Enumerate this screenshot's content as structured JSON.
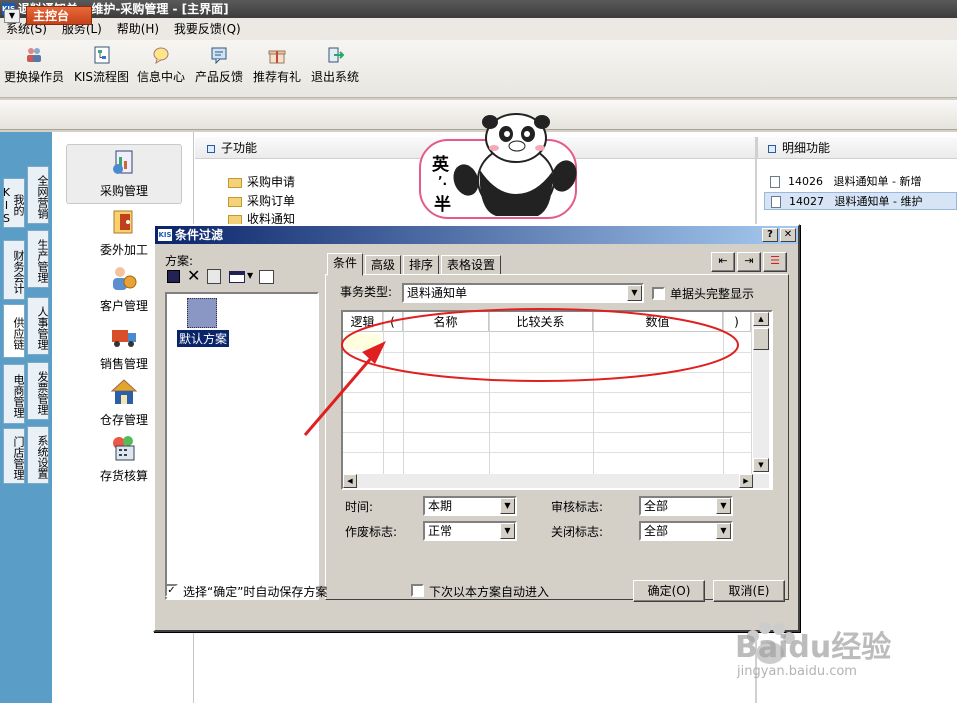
{
  "app": {
    "title": "退料通知单 - 维护-采购管理 - [主界面]",
    "logo_text": "KIS"
  },
  "menu": [
    "系统(S)",
    "服务(L)",
    "帮助(H)",
    "我要反馈(Q)"
  ],
  "toolbar": [
    {
      "label": "更换操作员",
      "icon": "users-icon"
    },
    {
      "label": "KIS流程图",
      "icon": "flowchart-icon"
    },
    {
      "label": "信息中心",
      "icon": "message-icon"
    },
    {
      "label": "产品反馈",
      "icon": "feedback-icon"
    },
    {
      "label": "推荐有礼",
      "icon": "gift-icon"
    },
    {
      "label": "退出系统",
      "icon": "exit-icon"
    }
  ],
  "console": {
    "label": "主控台"
  },
  "left_tabs": [
    {
      "label": "我的KIS"
    },
    {
      "label": "全网营销"
    },
    {
      "label": "财务会计"
    },
    {
      "label": "生产管理"
    },
    {
      "label": "供应链"
    },
    {
      "label": "人事管理"
    },
    {
      "label": "电商管理"
    },
    {
      "label": "发票管理"
    },
    {
      "label": "门店管理"
    },
    {
      "label": "系统设置"
    }
  ],
  "modules": [
    {
      "label": "采购管理",
      "icon": "purchase-icon"
    },
    {
      "label": "委外加工",
      "icon": "outsource-icon"
    },
    {
      "label": "客户管理",
      "icon": "customer-icon"
    },
    {
      "label": "销售管理",
      "icon": "sales-icon"
    },
    {
      "label": "仓存管理",
      "icon": "warehouse-icon"
    },
    {
      "label": "存货核算",
      "icon": "calculator-icon"
    }
  ],
  "sub_functions": {
    "header": "子功能",
    "items": [
      "采购申请",
      "采购订单",
      "收料通知"
    ]
  },
  "detail_functions": {
    "header": "明细功能",
    "items": [
      {
        "code": "14026",
        "name": "退料通知单 - 新增"
      },
      {
        "code": "14027",
        "name": "退料通知单 - 维护"
      }
    ]
  },
  "sticker": {
    "text1": "英",
    "text2": "半"
  },
  "dialog": {
    "title": "条件过滤",
    "scheme_label": "方案:",
    "default_scheme": "默认方案",
    "tabs": [
      "条件",
      "高级",
      "排序",
      "表格设置"
    ],
    "transaction_type_label": "事务类型:",
    "transaction_type_value": "退料通知单",
    "full_header_label": "单据头完整显示",
    "grid_headers": [
      "逻辑",
      "(",
      "名称",
      "比较关系",
      "数值",
      ")"
    ],
    "filters": [
      {
        "label": "时间:",
        "value": "本期"
      },
      {
        "label": "审核标志:",
        "value": "全部"
      },
      {
        "label": "作废标志:",
        "value": "正常"
      },
      {
        "label": "关闭标志:",
        "value": "全部"
      }
    ],
    "autosave_label": "选择“确定”时自动保存方案",
    "autosave_checked": true,
    "next_auto_label": "下次以本方案自动进入",
    "next_auto_checked": false,
    "ok_label": "确定(O)",
    "cancel_label": "取消(E)",
    "help_glyph": "?",
    "close_glyph": "✕"
  },
  "watermark": {
    "brand": "Baidu经验",
    "url": "jingyan.baidu.com"
  },
  "colors": {
    "annotation": "#e02020",
    "console": "#d9542a",
    "left_bar": "#5a9ec8"
  }
}
